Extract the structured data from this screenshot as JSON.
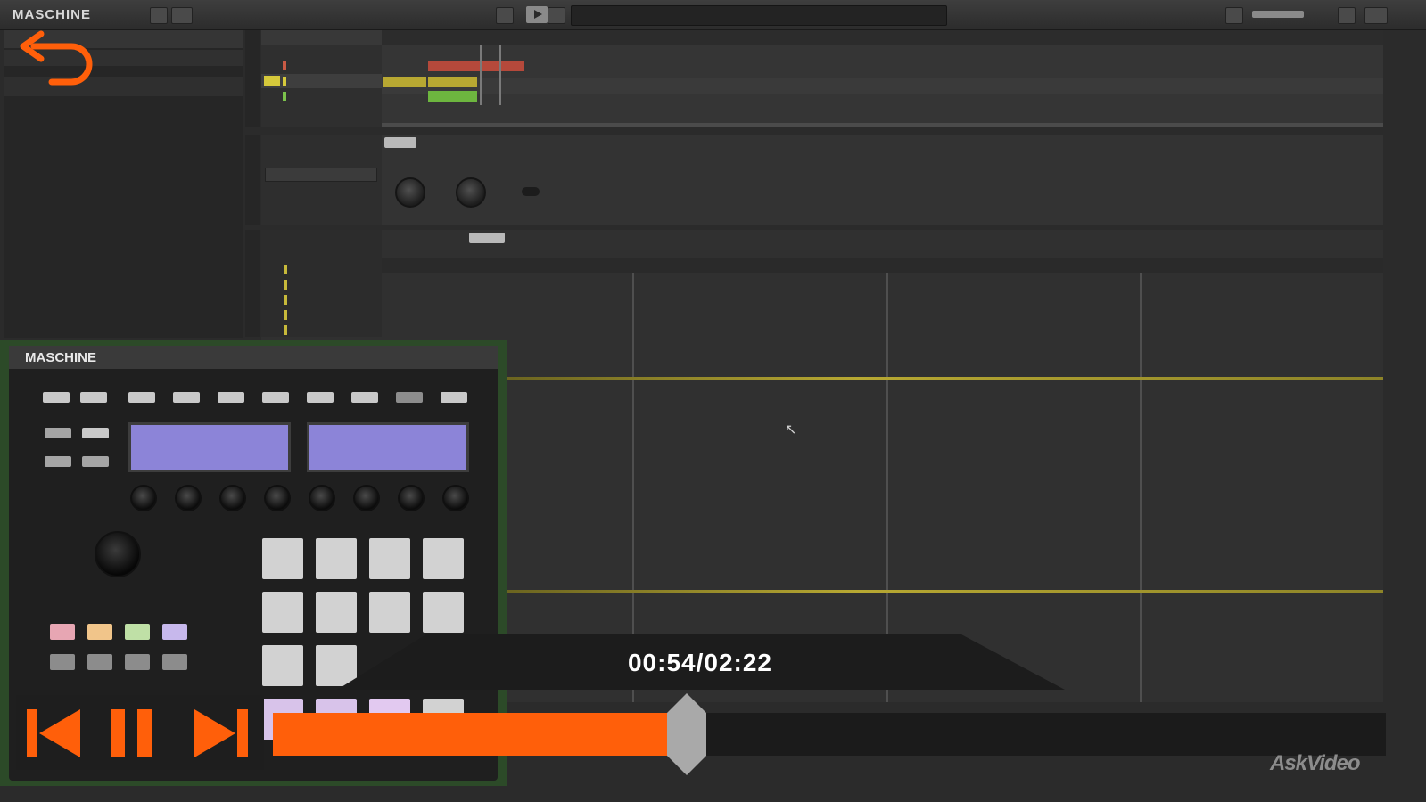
{
  "app": {
    "name": "MASCHINE"
  },
  "playback": {
    "current": "00:54",
    "total": "02:22",
    "display": "00:54/02:22",
    "progress": 0.37
  },
  "branding": {
    "watermark": "AskVideo"
  },
  "hardware": {
    "logo": "MASCHINE"
  },
  "colors": {
    "accent": "#ff5f0a",
    "pattern_line": "#b7a832",
    "screen": "#8c84d8"
  },
  "icons": {
    "back": "back-arrow-icon",
    "skip_back": "skip-back-icon",
    "pause": "pause-icon",
    "skip_forward": "skip-forward-icon",
    "cursor": "mouse-cursor-icon"
  }
}
